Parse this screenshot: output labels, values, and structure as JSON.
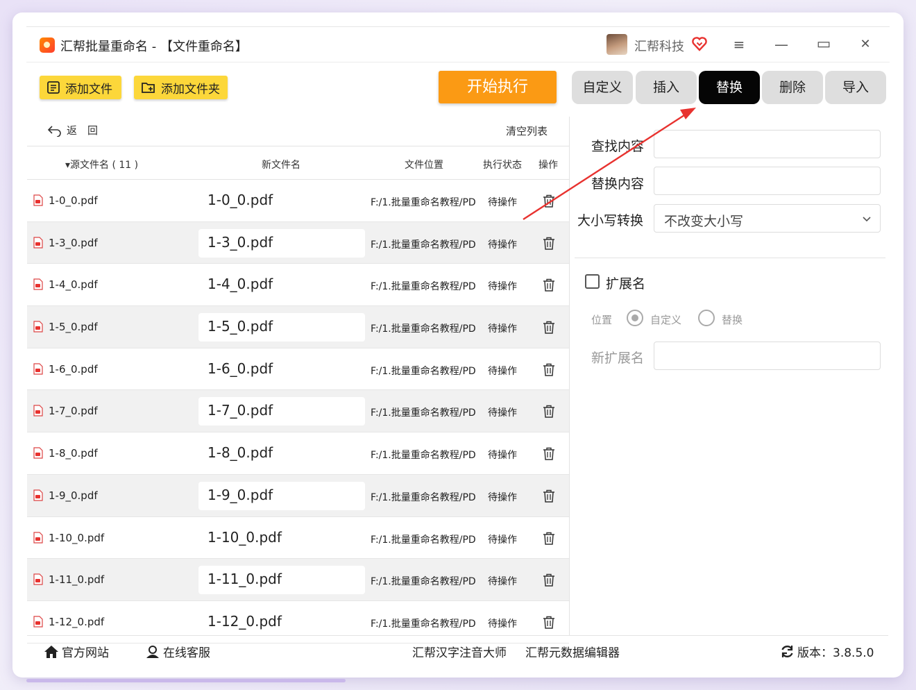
{
  "window": {
    "title": "汇帮批量重命名 - 【文件重命名】",
    "company": "汇帮科技",
    "controls": {
      "menu": "≡",
      "minimize": "—",
      "maximize": "▭",
      "close": "✕"
    }
  },
  "toolbar": {
    "add_files": "添加文件",
    "add_folder": "添加文件夹",
    "start": "开始执行"
  },
  "tabs": [
    {
      "label": "自定义",
      "active": false
    },
    {
      "label": "插入",
      "active": false
    },
    {
      "label": "替换",
      "active": true
    },
    {
      "label": "删除",
      "active": false
    },
    {
      "label": "导入",
      "active": false
    }
  ],
  "list": {
    "back_label": "返　回",
    "clear_label": "清空列表",
    "headers": {
      "source": "▾源文件名 ( 11 )",
      "new_name": "新文件名",
      "location": "文件位置",
      "status": "执行状态",
      "action": "操作"
    },
    "rows": [
      {
        "orig": "1-0_0.pdf",
        "new": "1-0_0.pdf",
        "loc": "F:/1.批量重命名教程/PD",
        "status": "待操作"
      },
      {
        "orig": "1-3_0.pdf",
        "new": "1-3_0.pdf",
        "loc": "F:/1.批量重命名教程/PD",
        "status": "待操作"
      },
      {
        "orig": "1-4_0.pdf",
        "new": "1-4_0.pdf",
        "loc": "F:/1.批量重命名教程/PD",
        "status": "待操作"
      },
      {
        "orig": "1-5_0.pdf",
        "new": "1-5_0.pdf",
        "loc": "F:/1.批量重命名教程/PD",
        "status": "待操作"
      },
      {
        "orig": "1-6_0.pdf",
        "new": "1-6_0.pdf",
        "loc": "F:/1.批量重命名教程/PD",
        "status": "待操作"
      },
      {
        "orig": "1-7_0.pdf",
        "new": "1-7_0.pdf",
        "loc": "F:/1.批量重命名教程/PD",
        "status": "待操作"
      },
      {
        "orig": "1-8_0.pdf",
        "new": "1-8_0.pdf",
        "loc": "F:/1.批量重命名教程/PD",
        "status": "待操作"
      },
      {
        "orig": "1-9_0.pdf",
        "new": "1-9_0.pdf",
        "loc": "F:/1.批量重命名教程/PD",
        "status": "待操作"
      },
      {
        "orig": "1-10_0.pdf",
        "new": "1-10_0.pdf",
        "loc": "F:/1.批量重命名教程/PD",
        "status": "待操作"
      },
      {
        "orig": "1-11_0.pdf",
        "new": "1-11_0.pdf",
        "loc": "F:/1.批量重命名教程/PD",
        "status": "待操作"
      },
      {
        "orig": "1-12_0.pdf",
        "new": "1-12_0.pdf",
        "loc": "F:/1.批量重命名教程/PD",
        "status": "待操作"
      }
    ]
  },
  "replace_panel": {
    "find_label": "查找内容",
    "find_value": "",
    "replace_label": "替换内容",
    "replace_value": "",
    "case_label": "大小写转换",
    "case_value": "不改变大小写",
    "ext_label": "扩展名",
    "position_label": "位置",
    "radio_custom": "自定义",
    "radio_replace": "替换",
    "new_ext_label": "新扩展名",
    "new_ext_value": ""
  },
  "footer": {
    "website": "官方网站",
    "support": "在线客服",
    "tool1": "汇帮汉字注音大师",
    "tool2": "汇帮元数据编辑器",
    "version": "版本：3.8.5.0"
  },
  "colors": {
    "accent_yellow": "#fcd73a",
    "start_orange": "#fb9a14",
    "active_tab": "#050505",
    "annotation_arrow": "#e8322f"
  },
  "icons": [
    "app-icon",
    "avatar",
    "vip-heart-icon",
    "menu-icon",
    "minimize-icon",
    "maximize-icon",
    "close-icon",
    "add-file-icon",
    "add-folder-icon",
    "back-arrow-icon",
    "pdf-icon",
    "trash-icon",
    "chevron-down-icon",
    "home-icon",
    "user-icon",
    "refresh-icon"
  ]
}
